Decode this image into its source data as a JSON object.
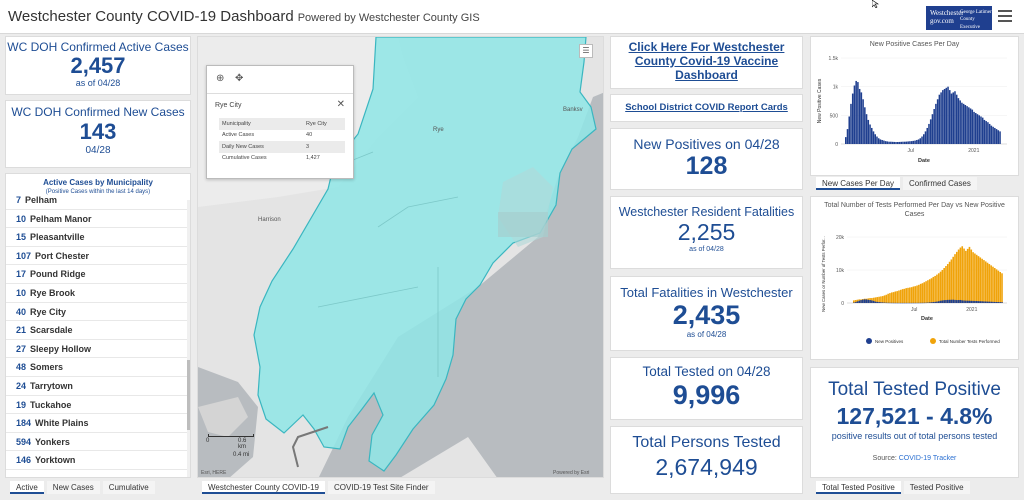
{
  "header": {
    "title": "Westchester County COVID-19 Dashboard",
    "subtitle": "Powered by Westchester County GIS",
    "logo_text_1": "Westchester",
    "logo_text_2": "gov.com",
    "logo_text_3": "George Latimer",
    "logo_text_4": "County Executive"
  },
  "left": {
    "active_cases": {
      "title": "WC DOH Confirmed Active Cases",
      "value": "2,457",
      "note": "as of 04/28"
    },
    "new_cases": {
      "title": "WC DOH Confirmed New Cases",
      "value": "143",
      "note": "04/28"
    },
    "list_title": "Active Cases by Municipality",
    "list_subtitle": "(Positive Cases within the last 14 days)",
    "municipalities": [
      {
        "num": "7",
        "name": "Pelham"
      },
      {
        "num": "10",
        "name": "Pelham Manor"
      },
      {
        "num": "15",
        "name": "Pleasantville"
      },
      {
        "num": "107",
        "name": "Port Chester"
      },
      {
        "num": "17",
        "name": "Pound Ridge"
      },
      {
        "num": "10",
        "name": "Rye Brook"
      },
      {
        "num": "40",
        "name": "Rye City"
      },
      {
        "num": "21",
        "name": "Scarsdale"
      },
      {
        "num": "27",
        "name": "Sleepy Hollow"
      },
      {
        "num": "48",
        "name": "Somers"
      },
      {
        "num": "24",
        "name": "Tarrytown"
      },
      {
        "num": "19",
        "name": "Tuckahoe"
      },
      {
        "num": "184",
        "name": "White Plains"
      },
      {
        "num": "594",
        "name": "Yonkers"
      },
      {
        "num": "146",
        "name": "Yorktown"
      }
    ],
    "tabs": [
      "Active",
      "New Cases",
      "Cumulative"
    ]
  },
  "map": {
    "badge": "40",
    "labels": {
      "rye": "Rye",
      "harrison": "Harrison",
      "banksville": "Banksv"
    },
    "popup": {
      "title": "Rye City",
      "rows": [
        {
          "k": "Municipality",
          "v": "Rye City"
        },
        {
          "k": "Active Cases",
          "v": "40"
        },
        {
          "k": "Daily New Cases",
          "v": "3"
        },
        {
          "k": "Cumulative Cases",
          "v": "1,427"
        }
      ]
    },
    "scale_km": "0.6 km",
    "scale_mi": "0.4 mi",
    "scale_zero": "0",
    "attribution": "Esri, HERE",
    "powered": "Powered by Esri",
    "tabs": [
      "Westchester County COVID-19",
      "COVID-19 Test Site Finder"
    ]
  },
  "middle": {
    "vaccine_link": "Click Here For Westchester County Covid-19 Vaccine Dashboard",
    "school_link": "School District COVID Report Cards",
    "new_positives": {
      "title": "New Positives on 04/28",
      "value": "128"
    },
    "resident_fatalities": {
      "title": "Westchester Resident Fatalities",
      "value": "2,255",
      "note": "as of 04/28"
    },
    "total_fatalities": {
      "title": "Total Fatalities in Westchester",
      "value": "2,435",
      "note": "as of 04/28"
    },
    "total_tested_day": {
      "title": "Total Tested on 04/28",
      "value": "9,996"
    },
    "total_persons": {
      "title": "Total Persons Tested",
      "value": "2,674,949"
    }
  },
  "right": {
    "chart1_tabs": [
      "New Cases Per Day",
      "Confirmed Cases"
    ],
    "chart2_title": "Total Number of Tests Performed Per Day vs New Positive Cases",
    "tested_positive": {
      "title": "Total Tested Positive",
      "value": "127,521 - 4.8%",
      "note": "positive results out of total persons tested",
      "source_label": "Source:",
      "source_link": "COVID-19 Tracker"
    },
    "bottom_tabs": [
      "Total Tested Positive",
      "Tested Positive"
    ]
  },
  "chart_data": [
    {
      "type": "bar",
      "title": "New Positive Cases Per Day",
      "xlabel": "Date",
      "ylabel": "New Positive Cases",
      "yticks": [
        "0",
        "500",
        "1k",
        "1.5k"
      ],
      "xticks": [
        "Jul",
        "2021"
      ],
      "ylim": [
        0,
        1500
      ],
      "color": "#1f3f8f",
      "values": [
        120,
        260,
        480,
        700,
        880,
        1020,
        1100,
        1080,
        960,
        900,
        780,
        640,
        520,
        420,
        340,
        280,
        220,
        170,
        130,
        100,
        80,
        70,
        60,
        50,
        45,
        40,
        40,
        38,
        36,
        35,
        35,
        36,
        38,
        40,
        40,
        42,
        45,
        48,
        50,
        55,
        60,
        70,
        80,
        100,
        130,
        170,
        220,
        280,
        350,
        430,
        520,
        610,
        700,
        780,
        860,
        900,
        940,
        960,
        980,
        1000,
        940,
        880,
        900,
        920,
        860,
        800,
        760,
        720,
        700,
        680,
        660,
        640,
        620,
        600,
        560,
        540,
        520,
        500,
        480,
        460,
        420,
        400,
        380,
        350,
        320,
        300,
        280,
        260,
        240,
        220
      ]
    },
    {
      "type": "bar",
      "title": "Total Number of Tests Performed Per Day vs New Positive Cases",
      "xlabel": "Date",
      "ylabel": "New Cases or Number of Tests Perfor...",
      "yticks": [
        "0",
        "10k",
        "20k"
      ],
      "xticks": [
        "Jul",
        "2021"
      ],
      "ylim": [
        0,
        20000
      ],
      "series": [
        {
          "name": "New Positives",
          "color": "#1f3f8f"
        },
        {
          "name": "Total Number Tests Performed",
          "color": "#f0a30a"
        }
      ],
      "tests": [
        800,
        900,
        1000,
        1100,
        1100,
        1200,
        1300,
        1300,
        1400,
        1500,
        1500,
        1600,
        1700,
        1800,
        1900,
        2000,
        2100,
        2300,
        2500,
        2800,
        3000,
        3200,
        3300,
        3500,
        3600,
        3800,
        4000,
        4200,
        4300,
        4500,
        4600,
        4700,
        4800,
        5000,
        5100,
        5300,
        5500,
        5800,
        6000,
        6300,
        6600,
        6900,
        7200,
        7500,
        7900,
        8200,
        8600,
        9000,
        9500,
        10000,
        10600,
        11200,
        11800,
        12500,
        13200,
        14000,
        14800,
        15500,
        16200,
        16800,
        17200,
        16500,
        15800,
        16400,
        17000,
        16200,
        15400,
        15000,
        14600,
        14200,
        13800,
        13400,
        13000,
        12600,
        12200,
        11800,
        11400,
        11000,
        10600,
        10200,
        9800,
        9400,
        9000
      ]
    }
  ]
}
